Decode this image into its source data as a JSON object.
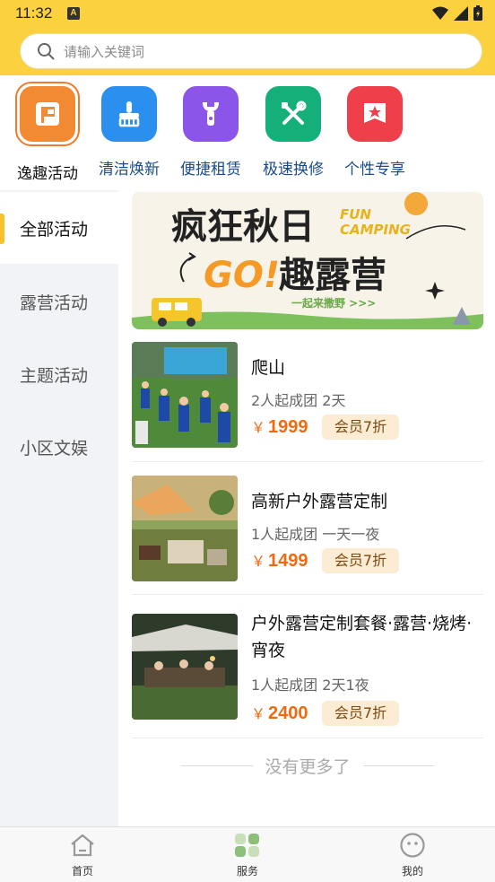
{
  "status": {
    "time": "11:32",
    "indicator": "A"
  },
  "search": {
    "placeholder": "请输入关键词"
  },
  "categories": [
    {
      "label": "逸趣活动",
      "icon": "flag-icon",
      "color": "#f28a34",
      "selected": true
    },
    {
      "label": "清洁焕新",
      "icon": "broom-icon",
      "color": "#2b8ff0"
    },
    {
      "label": "便捷租赁",
      "icon": "wrench-icon",
      "color": "#8a55e8"
    },
    {
      "label": "极速换修",
      "icon": "tools-icon",
      "color": "#15b07a"
    },
    {
      "label": "个性专享",
      "icon": "star-badge-icon",
      "color": "#ef3f4a"
    }
  ],
  "sidebar": {
    "items": [
      {
        "label": "全部活动",
        "active": true
      },
      {
        "label": "露营活动"
      },
      {
        "label": "主题活动"
      },
      {
        "label": "小区文娱"
      }
    ]
  },
  "banner": {
    "title": "疯狂秋日",
    "fun_line1": "FUN",
    "fun_line2": "CAMPING",
    "go": "GO!",
    "subtitle": "趣露营",
    "tagline": "一起来撒野 >>>"
  },
  "activities": [
    {
      "title": "爬山",
      "group": "2人起成团 2天",
      "price": "1999",
      "currency": "￥",
      "badge": "会员7折"
    },
    {
      "title": "高新户外露营定制",
      "group": "1人起成团 一天一夜",
      "price": "1499",
      "currency": "￥",
      "badge": "会员7折"
    },
    {
      "title": "户外露营定制套餐·露营·烧烤·宵夜",
      "group": "1人起成团 2天1夜",
      "price": "2400",
      "currency": "￥",
      "badge": "会员7折"
    }
  ],
  "no_more": "没有更多了",
  "tabbar": [
    {
      "label": "首页",
      "icon": "home-icon"
    },
    {
      "label": "服务",
      "icon": "services-icon",
      "active": true
    },
    {
      "label": "我的",
      "icon": "profile-icon"
    }
  ],
  "colors": {
    "header": "#fcd13f",
    "accent": "#f06a0f",
    "sidebar_bg": "#f2f3f7",
    "badge_bg": "#fdecd4"
  }
}
